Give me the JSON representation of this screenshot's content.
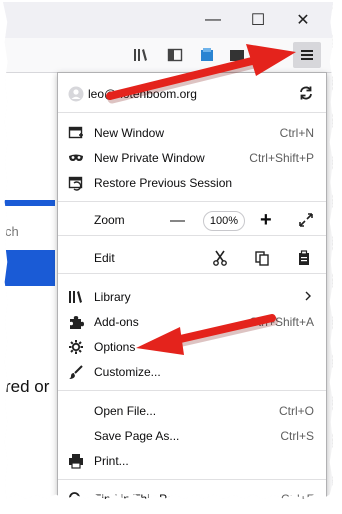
{
  "window": {
    "minimize_glyph": "—",
    "maximize_glyph": "☐",
    "close_glyph": "✕"
  },
  "background_page": {
    "search_fragment": "ch",
    "text_fragment": "red or"
  },
  "account": {
    "email": "leo@notenboom.org"
  },
  "menu": {
    "new_window": {
      "label": "New Window",
      "shortcut": "Ctrl+N"
    },
    "new_private_window": {
      "label": "New Private Window",
      "shortcut": "Ctrl+Shift+P"
    },
    "restore_session": {
      "label": "Restore Previous Session"
    },
    "zoom": {
      "label": "Zoom",
      "minus": "—",
      "value": "100%",
      "plus": "+"
    },
    "edit": {
      "label": "Edit"
    },
    "library": {
      "label": "Library"
    },
    "addons": {
      "label": "Add-ons",
      "shortcut": "Ctrl+Shift+A"
    },
    "options": {
      "label": "Options"
    },
    "customize": {
      "label": "Customize..."
    },
    "open_file": {
      "label": "Open File...",
      "shortcut": "Ctrl+O"
    },
    "save_page": {
      "label": "Save Page As...",
      "shortcut": "Ctrl+S"
    },
    "print": {
      "label": "Print..."
    },
    "find_partial": {
      "label": "Find in This Pa...",
      "shortcut": "Ctrl+F"
    }
  },
  "colors": {
    "arrow_red": "#e4231c",
    "bg_blue": "#1a5bd6",
    "menu_button_bg": "#d7d7db"
  }
}
